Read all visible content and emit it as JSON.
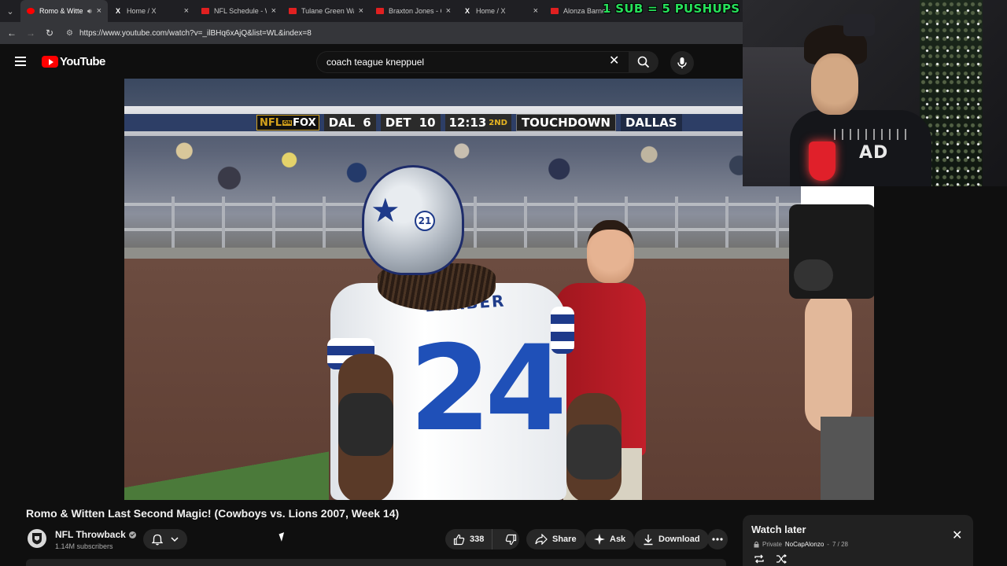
{
  "browser": {
    "tabs": [
      {
        "label": "Romo & Witten",
        "favicon": "youtube-icon",
        "active": true
      },
      {
        "label": "Home / X",
        "favicon": "x-icon"
      },
      {
        "label": "NFL Schedule - W",
        "favicon": "espn-icon"
      },
      {
        "label": "Tulane Green Wa",
        "favicon": "espn-icon"
      },
      {
        "label": "Braxton Jones - C",
        "favicon": "espn-icon"
      },
      {
        "label": "Home / X",
        "favicon": "x-icon"
      },
      {
        "label": "Alonza Barnett",
        "favicon": "espn-icon"
      }
    ],
    "url": "https://www.youtube.com/watch?v=_ilBHq6xAjQ&list=WL&index=8"
  },
  "stream_overlay": {
    "text": "1 SUB = 5 PUSHUPS"
  },
  "youtube": {
    "logo_text": "YouTube",
    "search_query": "coach teague kneppuel"
  },
  "scorebug": {
    "network_nfl": "NFL",
    "network_on": "ON",
    "network_fox": "FOX",
    "away_team": "DAL",
    "away_score": "6",
    "home_team": "DET",
    "home_score": "10",
    "clock": "12:13",
    "quarter": "2ND",
    "banner": "TOUCHDOWN",
    "banner_team": "DALLAS"
  },
  "video_scene": {
    "jersey_number": "24",
    "helmet_number": "21",
    "nameplate": "BARBER",
    "webcam_shirt_text": "AD"
  },
  "video_info": {
    "title": "Romo & Witten Last Second Magic! (Cowboys vs. Lions 2007, Week 14)",
    "channel_name": "NFL Throwback",
    "subscribers": "1.14M subscribers"
  },
  "actions": {
    "like_count": "338",
    "share_label": "Share",
    "ask_label": "Ask",
    "download_label": "Download"
  },
  "watch_later": {
    "title": "Watch later",
    "privacy": "Private",
    "owner": "NoCapAlonzo",
    "position": "7 / 28"
  },
  "colors": {
    "youtube_red": "#ff0000",
    "overlay_green": "#27e05a",
    "background": "#0f0f0f"
  }
}
